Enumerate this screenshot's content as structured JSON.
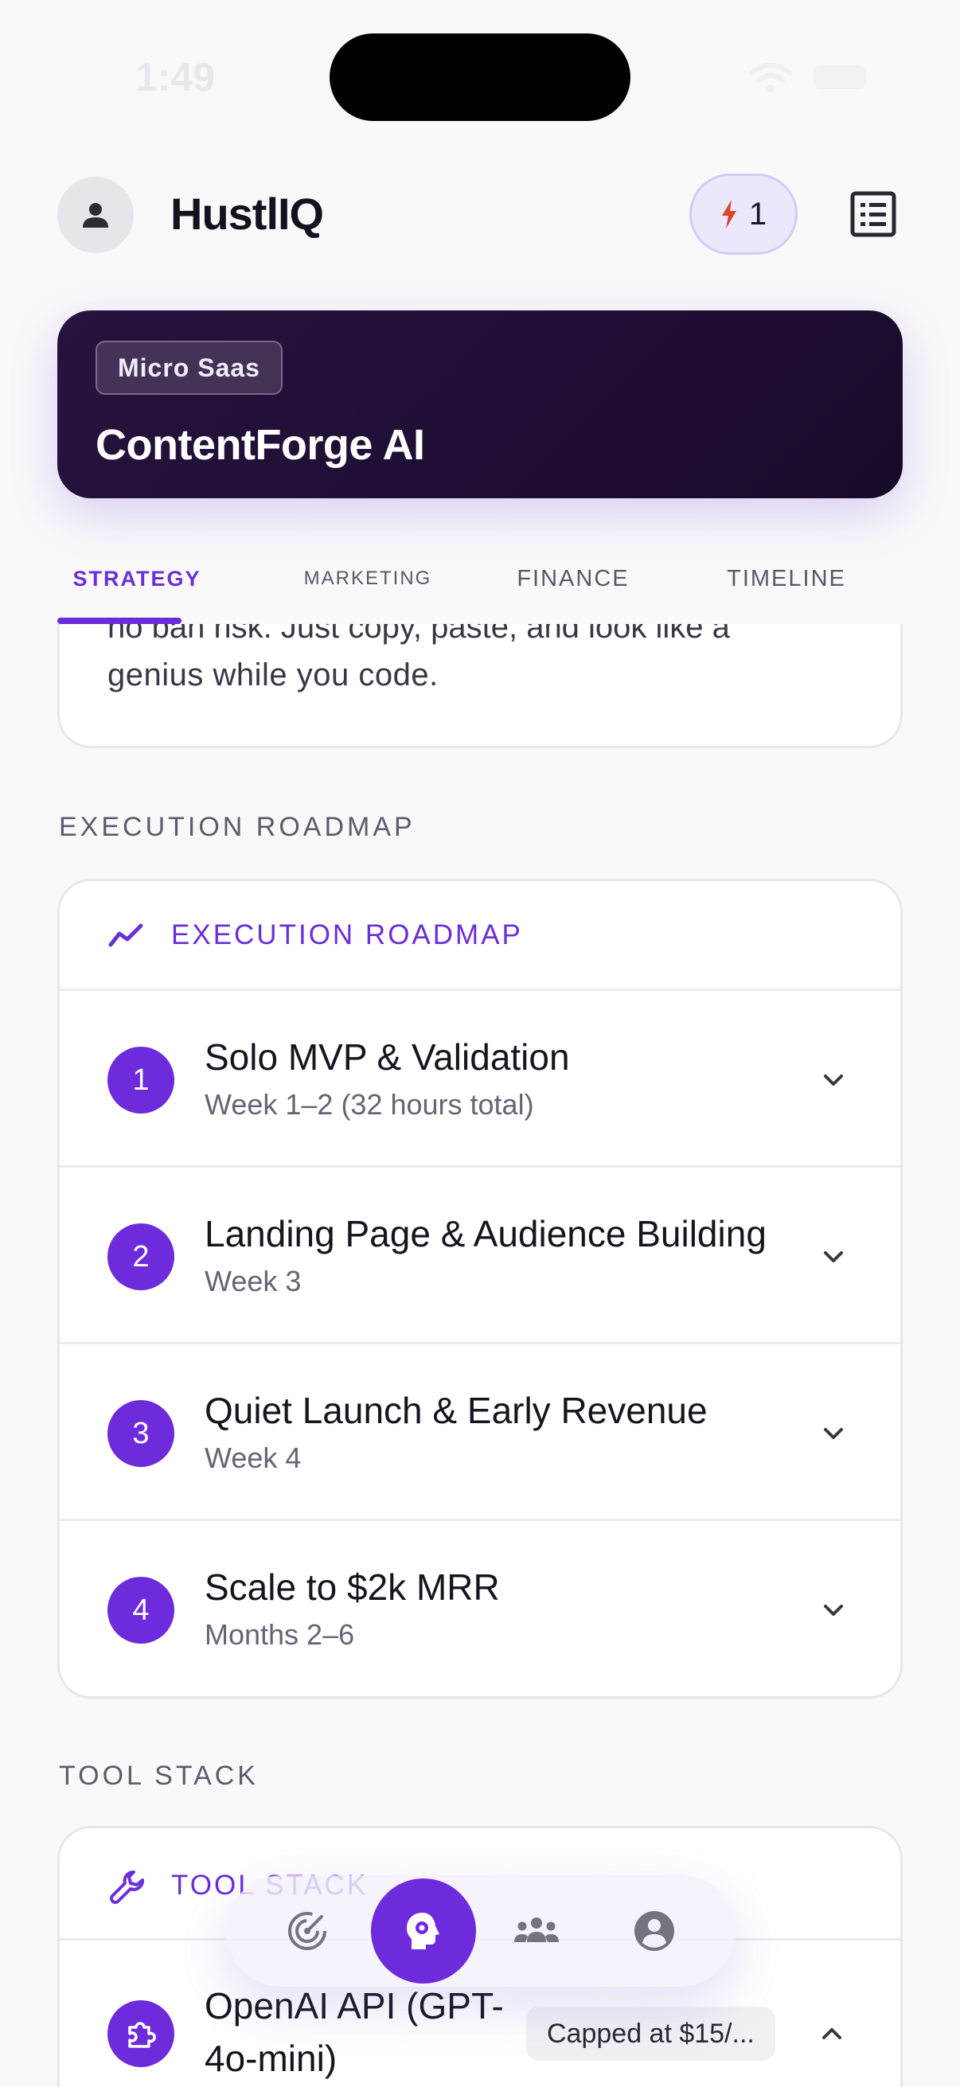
{
  "status_bar": {
    "time": "1:49"
  },
  "header": {
    "app_title": "HustlIQ",
    "credits": "1"
  },
  "hero": {
    "category": "Micro Saas",
    "title": "ContentForge AI"
  },
  "tabs": [
    {
      "label": "STRATEGY",
      "active": true
    },
    {
      "label": "MARKETING",
      "active": false
    },
    {
      "label": "FINANCE",
      "active": false
    },
    {
      "label": "TIMELINE",
      "active": false
    }
  ],
  "description": {
    "partial_line": "no ban risk. Just copy, paste, and look like a",
    "last_line": "genius while you code."
  },
  "roadmap": {
    "section_label": "EXECUTION ROADMAP",
    "card_title": "EXECUTION ROADMAP",
    "steps": [
      {
        "number": "1",
        "title": "Solo MVP & Validation",
        "subtitle": "Week 1–2 (32 hours total)"
      },
      {
        "number": "2",
        "title": "Landing Page & Audience Building",
        "subtitle": "Week 3"
      },
      {
        "number": "3",
        "title": "Quiet Launch & Early Revenue",
        "subtitle": "Week 4"
      },
      {
        "number": "4",
        "title": "Scale to $2k MRR",
        "subtitle": "Months 2–6"
      }
    ]
  },
  "tool_stack": {
    "section_label": "TOOL STACK",
    "card_title": "TOOL STACK",
    "tools": [
      {
        "name": "OpenAI API (GPT-4o-mini)",
        "cost": "Capped at $15/..."
      }
    ]
  },
  "bottom_nav": [
    {
      "icon": "radar-icon",
      "active": false
    },
    {
      "icon": "brain-gear-icon",
      "active": true
    },
    {
      "icon": "community-icon",
      "active": false
    },
    {
      "icon": "profile-icon",
      "active": false
    }
  ],
  "colors": {
    "accent": "#6d2bdc",
    "hero_bg": "#1e0e33",
    "background": "#f9f9fa"
  }
}
